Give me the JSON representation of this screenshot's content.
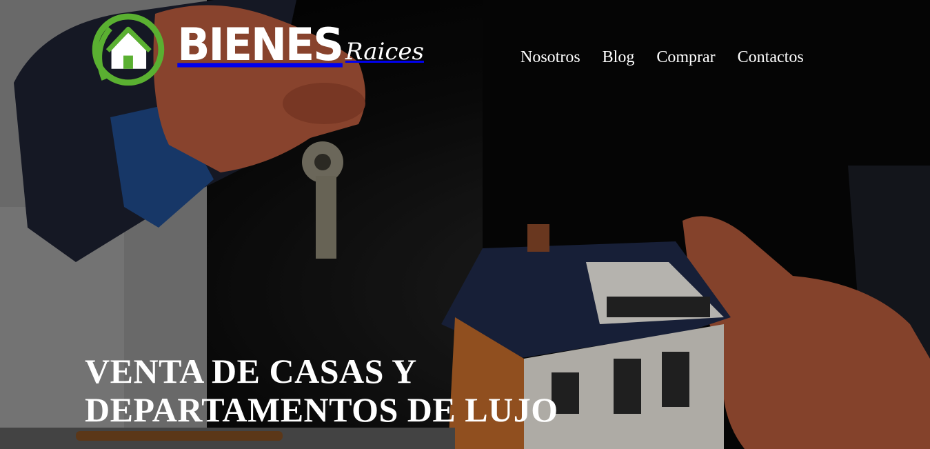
{
  "brand": {
    "logo_primary": "BIENES",
    "logo_secondary": "Raices",
    "accent_color": "#5ab031",
    "icon": "house-logo-icon"
  },
  "nav": {
    "items": [
      {
        "label": "Nosotros"
      },
      {
        "label": "Blog"
      },
      {
        "label": "Comprar"
      },
      {
        "label": "Contactos"
      }
    ]
  },
  "hero": {
    "title_line1": "VENTA DE CASAS Y",
    "title_line2": "DEPARTAMENTOS DE LUJO",
    "background": "hand-holding-keys-and-model-house"
  }
}
